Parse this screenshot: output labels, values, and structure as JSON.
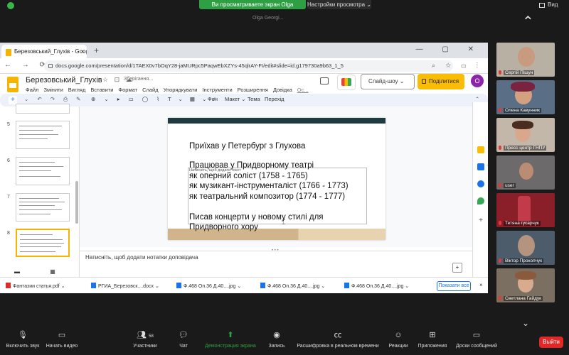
{
  "zoom_top": {
    "share_banner": "Ви просматриваете экран Olga",
    "view_options": "Настройки просмотра ⌄",
    "view_label": "Вид",
    "share_name_hint": "Olga Georgi..."
  },
  "browser": {
    "tab_title": "Березовський_Глухів - Google S",
    "url": "docs.google.com/presentation/d/1TAEX0v7bOqY28-jaMURpc5PaqwEbXZYs-45qlrAY-FI/edit#slide=id.g179730a9b63_1_5",
    "new_tab": "+",
    "close_tab": "×",
    "nav": "← → ⟳",
    "addr_icons": "⌕ ☆ ▭ ⋮",
    "win_ctrls": "— ▢ ✕"
  },
  "docs": {
    "title": "Березовський_Глухів",
    "title_icons": "☆ ⊡ ☁",
    "saving": "Зберігання...",
    "menu": [
      "Файл",
      "Змінити",
      "Вигляд",
      "Вставити",
      "Формат",
      "Слайд",
      "Упорядкувати",
      "Інструменти",
      "Розширення",
      "Довідка",
      "Ос..."
    ],
    "slideshow_label": "Слайд-шоу  ⌄",
    "share_label": "Поділитися",
    "avatar_letter": "O"
  },
  "toolbar": {
    "add": "+",
    "left_icons": "⌄ ↶ ↷ ⎙ ✎",
    "zoom_icons": "⊕ ⌄ ▸ ▭ ◯ ⌇",
    "text_tools": "T ⌄ ▦ ⌄ ∕",
    "background": "Фон",
    "layout": "Макет ⌄",
    "theme": "Тема",
    "transition": "Перехід",
    "collapse": "⌃"
  },
  "filmstrip": {
    "slide_numbers": [
      "5",
      "6",
      "7",
      "8"
    ],
    "bottom_icons": "▬ ▦"
  },
  "slide": {
    "title": "Приїхав у Петербург з Глухова",
    "body": [
      "Працював у Придворному театрі",
      "як оперний соліст (1758 - 1765)",
      "як музикант-інструменталіст (1766 - 1773)",
      "як театральний композитор (1774 - 1777)",
      "",
      "Писав концерти у новому стилі для",
      "Придворного хору"
    ],
    "placeholder": "Натисніть, щоб додати текст"
  },
  "notes": {
    "placeholder": "Натисніть, щоб додати нотатки доповідача",
    "drag_handle": "• • •",
    "add_button": "+"
  },
  "downloads": {
    "items": [
      {
        "name": "Фантазии статья.pdf",
        "type": "pdf"
      },
      {
        "name": "РГИА_Березовск....docx",
        "type": "doc"
      },
      {
        "name": "Ф.468 Оп.36 Д.40....jpg",
        "type": "pdf"
      },
      {
        "name": "Ф.468 Оп.36 Д.40....jpg",
        "type": "pdf"
      },
      {
        "name": "Ф.468 Оп.36 Д.40....jpg",
        "type": "pdf"
      }
    ],
    "chevron": "⌄",
    "show_all": "Показати все",
    "close": "×"
  },
  "gallery": {
    "participants": [
      "Сергій Пішун",
      "Олена Кавунник",
      "Пресс центр ГНПУ",
      "user",
      "Тетяна гусарчук",
      "Віктор Прокопчук",
      "Светлана Гайдук"
    ],
    "chevron_up": "⌃",
    "chevron_down": "⌄",
    "scroll_left": "‹"
  },
  "bottom": {
    "mute": "Включить звук",
    "video": "Начать видео",
    "participants": "Участники",
    "participants_count": "58",
    "chat": "Чат",
    "share": "Демонстрация экрана",
    "record": "Запись",
    "transcript": "Расшифровка в реальном времени",
    "reactions": "Реакции",
    "apps": "Приложения",
    "whiteboards": "Доски сообщений",
    "leave": "Выйти"
  },
  "colors": {
    "zoom_green": "#2ea043",
    "slides_yellow": "#f4b400",
    "leave_red": "#e02828",
    "slide_header": "#1f3b3f"
  }
}
